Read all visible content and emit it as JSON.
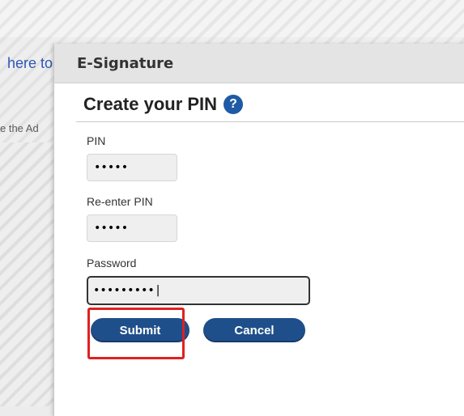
{
  "background": {
    "link_text": "here to",
    "text_fragment": "e the Ad"
  },
  "dialog": {
    "title": "E-Signature",
    "heading": "Create your PIN",
    "help_icon_glyph": "?"
  },
  "form": {
    "pin_label": "PIN",
    "pin_value": "•••••",
    "reenter_label": "Re-enter PIN",
    "reenter_value": "•••••",
    "password_label": "Password",
    "password_value": "•••••••••|"
  },
  "buttons": {
    "submit_label": "Submit",
    "cancel_label": "Cancel"
  },
  "colors": {
    "button_bg": "#1f4f8a",
    "help_icon_bg": "#1f5aa6",
    "highlight": "#e02020",
    "link": "#2f56b8"
  }
}
